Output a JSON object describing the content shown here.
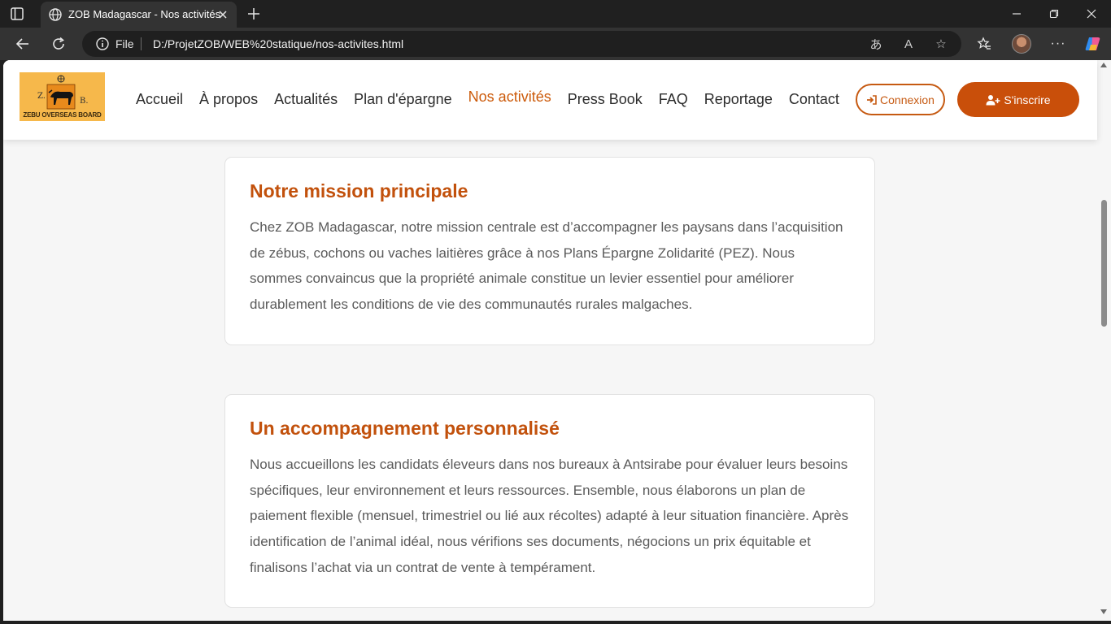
{
  "browser": {
    "tab_title": "ZOB Madagascar - Nos activités",
    "address_scheme": "File",
    "address_url": "D:/ProjetZOB/WEB%20statique/nos-activites.html",
    "icons": [
      "sidebar-icon",
      "globe-icon",
      "close-icon",
      "plus-icon",
      "minimize-icon",
      "restore-icon",
      "close-window-icon",
      "back-icon",
      "refresh-icon",
      "info-icon",
      "read-aloud-icon",
      "translate-icon",
      "favorite-star-icon",
      "favorites-icon",
      "profile-avatar",
      "more-icon",
      "copilot-icon"
    ]
  },
  "site": {
    "logo": {
      "letter_left": "Z.",
      "letter_right": "B.",
      "tagline": "ZEBU OVERSEAS BOARD"
    },
    "nav": [
      {
        "label": "Accueil"
      },
      {
        "label": "À propos"
      },
      {
        "label": "Actualités"
      },
      {
        "label": "Plan d'épargne"
      },
      {
        "label": "Nos activités",
        "active": true
      },
      {
        "label": "Press Book"
      },
      {
        "label": "FAQ"
      },
      {
        "label": "Reportage"
      },
      {
        "label": "Contact"
      }
    ],
    "login_label": "Connexion",
    "signup_label": "S'inscrire",
    "accent_color": "#c94f0a"
  },
  "cards": [
    {
      "title": "Notre mission principale",
      "body": "Chez ZOB Madagascar, notre mission centrale est d’accompagner les paysans dans l’acquisition de zébus, cochons ou vaches laitières grâce à nos Plans Épargne Zolidarité (PEZ). Nous sommes convaincus que la propriété animale constitue un levier essentiel pour améliorer durablement les conditions de vie des communautés rurales malgaches."
    },
    {
      "title": "Un accompagnement personnalisé",
      "body": "Nous accueillons les candidats éleveurs dans nos bureaux à Antsirabe pour évaluer leurs besoins spécifiques, leur environnement et leurs ressources. Ensemble, nous élaborons un plan de paiement flexible (mensuel, trimestriel ou lié aux récoltes) adapté à leur situation financière. Après identification de l’animal idéal, nous vérifions ses documents, négocions un prix équitable et finalisons l’achat via un contrat de vente à tempérament."
    }
  ]
}
